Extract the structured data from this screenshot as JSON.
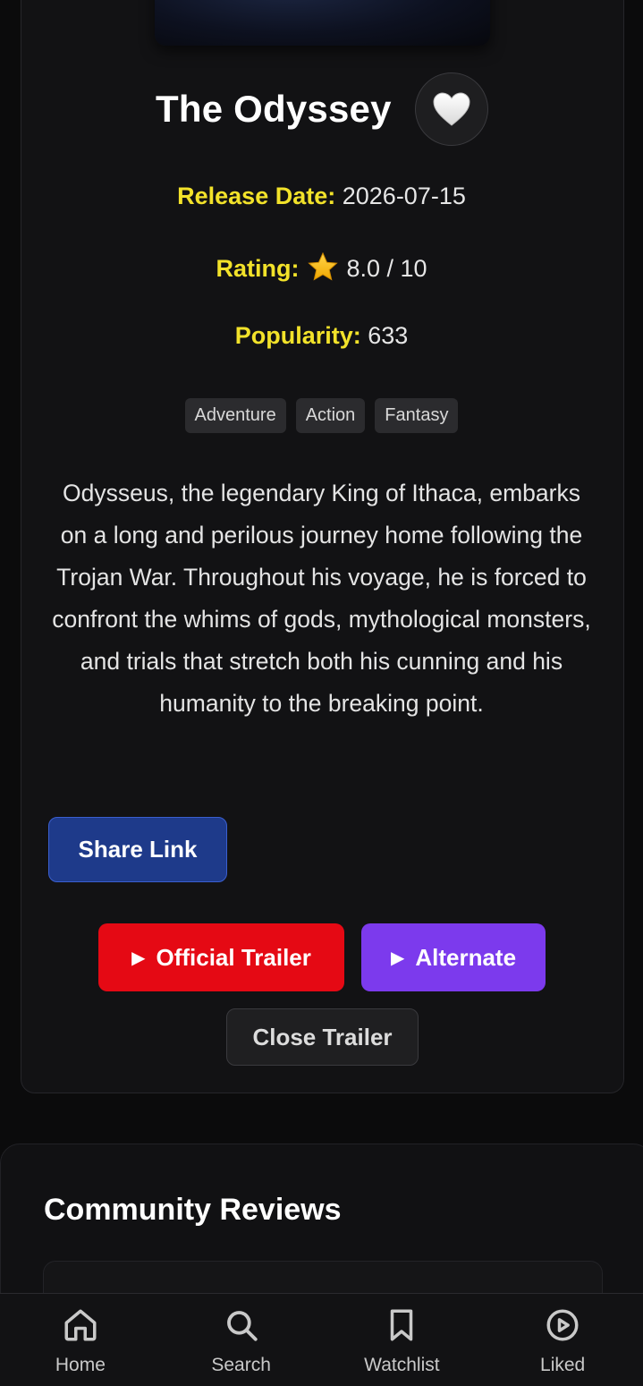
{
  "movie": {
    "title": "The Odyssey",
    "release_date_label": "Release Date:",
    "release_date": "2026-07-15",
    "rating_label": "Rating:",
    "rating_value": "8.0 / 10",
    "popularity_label": "Popularity:",
    "popularity": "633",
    "genres": [
      "Adventure",
      "Action",
      "Fantasy"
    ],
    "overview": "Odysseus, the legendary King of Ithaca, embarks on a long and perilous journey home following the Trojan War. Throughout his voyage, he is forced to confront the whims of gods, mythological monsters, and trials that stretch both his cunning and his humanity to the breaking point.",
    "like_icon": "white-heart-icon"
  },
  "actions": {
    "share_label": "Share Link",
    "official_trailer_label": "Official Trailer",
    "alternate_label": "Alternate",
    "close_trailer_label": "Close Trailer",
    "play_glyph": "▶"
  },
  "reviews": {
    "title": "Community Reviews"
  },
  "nav": {
    "items": [
      {
        "label": "Home",
        "icon": "home-icon"
      },
      {
        "label": "Search",
        "icon": "search-icon"
      },
      {
        "label": "Watchlist",
        "icon": "bookmark-icon"
      },
      {
        "label": "Liked",
        "icon": "play-circle-icon"
      }
    ]
  },
  "colors": {
    "background": "#0b0b0c",
    "label_yellow": "#f2e22a",
    "share_blue": "#1e3a8a",
    "official_red": "#e50914",
    "alternate_purple": "#7c3aed"
  }
}
